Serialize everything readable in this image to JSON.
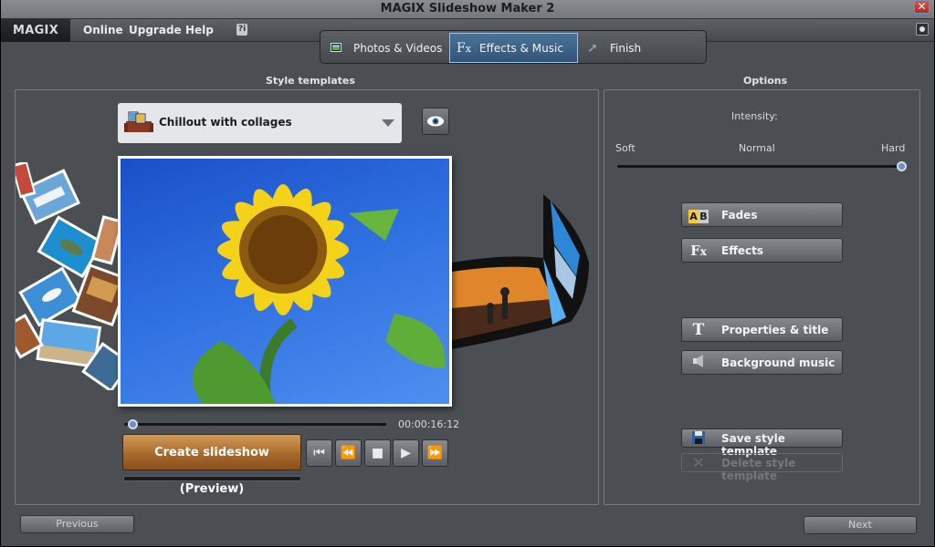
{
  "window": {
    "title": "MAGIX Slideshow Maker 2",
    "close_glyph": "✕"
  },
  "menu": {
    "logo": "MAGIX",
    "items": [
      {
        "label": "Online"
      },
      {
        "label": "Upgrade"
      },
      {
        "label": "Help"
      }
    ],
    "help_icon_glyph": "?i"
  },
  "workflow_tabs": [
    {
      "label": "Photos & Videos",
      "icon": "photo-icon",
      "active": false
    },
    {
      "label": "Effects & Music",
      "icon": "fx-icon",
      "active": true
    },
    {
      "label": "Finish",
      "icon": "arrow-up-right-icon",
      "active": false
    }
  ],
  "style_panel": {
    "heading": "Style templates",
    "selected_template": "Chillout with collages",
    "preview_button_icon": "eye-icon",
    "timecode": "00:00:16:12",
    "playback_position": 0.03,
    "create_button": "Create slideshow (Preview)",
    "transport": {
      "to_start": "⏮",
      "rewind": "⏪",
      "stop": "■",
      "play": "▶",
      "fast_forward": "⏩"
    }
  },
  "options_panel": {
    "heading": "Options",
    "intensity_label": "Intensity:",
    "scale": {
      "min": "Soft",
      "mid": "Normal",
      "max": "Hard"
    },
    "intensity_value": 1.0,
    "buttons": [
      {
        "label": "Fades",
        "icon": "ab-icon",
        "glyph": "AB"
      },
      {
        "label": "Effects",
        "icon": "fx-icon",
        "glyph": "Fx"
      },
      {
        "label": "Properties & title",
        "icon": "text-t-icon",
        "glyph": "T"
      },
      {
        "label": "Background music",
        "icon": "speaker-icon",
        "glyph": "◀"
      },
      {
        "label": "Save style template",
        "icon": "floppy-disk-icon",
        "glyph": "💾"
      },
      {
        "label": "Delete style template",
        "icon": "delete-x-icon",
        "glyph": "✕",
        "disabled": true
      }
    ]
  },
  "footer": {
    "previous": "Previous",
    "next": "Next"
  },
  "colors": {
    "accent_blue": "#3d6690",
    "create_orange": "#b5773a",
    "background": "#4b4e53"
  }
}
